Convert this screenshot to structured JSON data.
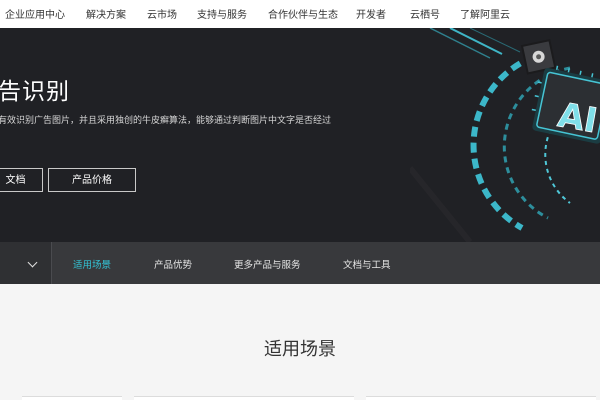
{
  "topnav": {
    "items": [
      {
        "label": "企业应用中心"
      },
      {
        "label": "解决方案"
      },
      {
        "label": "云市场"
      },
      {
        "label": "支持与服务"
      },
      {
        "label": "合作伙伴与生态"
      },
      {
        "label": "开发者"
      },
      {
        "label": "云栖号"
      },
      {
        "label": "了解阿里云"
      }
    ]
  },
  "hero": {
    "title": "告识别",
    "description": "有效识别广告图片，并且采用独创的牛皮癣算法，能够通过判断图片中文字是否经过",
    "docs_button": "文档",
    "price_button": "产品价格",
    "art_text": "AI"
  },
  "subnav": {
    "tabs": [
      {
        "label": "适用场景",
        "active": true
      },
      {
        "label": "产品优势",
        "active": false
      },
      {
        "label": "更多产品与服务",
        "active": false
      },
      {
        "label": "文档与工具",
        "active": false
      }
    ]
  },
  "section": {
    "title": "适用场景"
  },
  "colors": {
    "accent": "#33c4d6",
    "hero_bg": "#202125",
    "subnav_bg": "#38393c"
  }
}
